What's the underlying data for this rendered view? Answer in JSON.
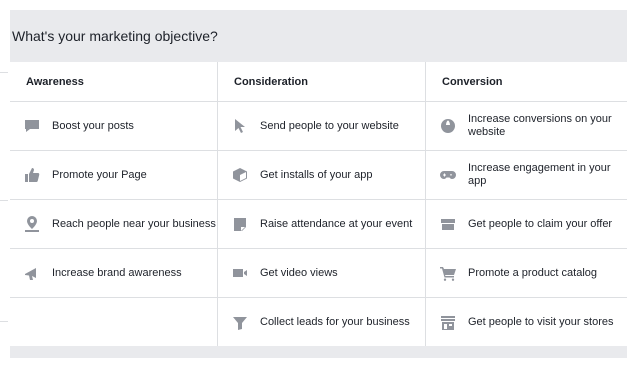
{
  "header": {
    "title": "What's your marketing objective?"
  },
  "columns": [
    {
      "heading": "Awareness",
      "items": [
        {
          "label": "Boost your posts",
          "icon": "speech-bubble-icon"
        },
        {
          "label": "Promote your Page",
          "icon": "thumbs-up-icon"
        },
        {
          "label": "Reach people near your business",
          "icon": "map-pin-icon"
        },
        {
          "label": "Increase brand awareness",
          "icon": "megaphone-icon"
        },
        {
          "label": "",
          "icon": ""
        }
      ]
    },
    {
      "heading": "Consideration",
      "items": [
        {
          "label": "Send people to your website",
          "icon": "cursor-icon"
        },
        {
          "label": "Get installs of your app",
          "icon": "box-icon"
        },
        {
          "label": "Raise attendance at your event",
          "icon": "calendar-icon"
        },
        {
          "label": "Get video views",
          "icon": "video-camera-icon"
        },
        {
          "label": "Collect leads for your business",
          "icon": "funnel-icon"
        }
      ]
    },
    {
      "heading": "Conversion",
      "items": [
        {
          "label": "Increase conversions on your website",
          "icon": "globe-icon"
        },
        {
          "label": "Increase engagement in your app",
          "icon": "gamepad-icon"
        },
        {
          "label": "Get people to claim your offer",
          "icon": "offer-icon"
        },
        {
          "label": "Promote a product catalog",
          "icon": "shopping-cart-icon"
        },
        {
          "label": "Get people to visit your stores",
          "icon": "storefront-icon"
        }
      ]
    }
  ],
  "colors": {
    "panel_bg": "#e9eaed",
    "divider": "#dddfe2",
    "icon": "#90949c",
    "text": "#1d2129"
  }
}
